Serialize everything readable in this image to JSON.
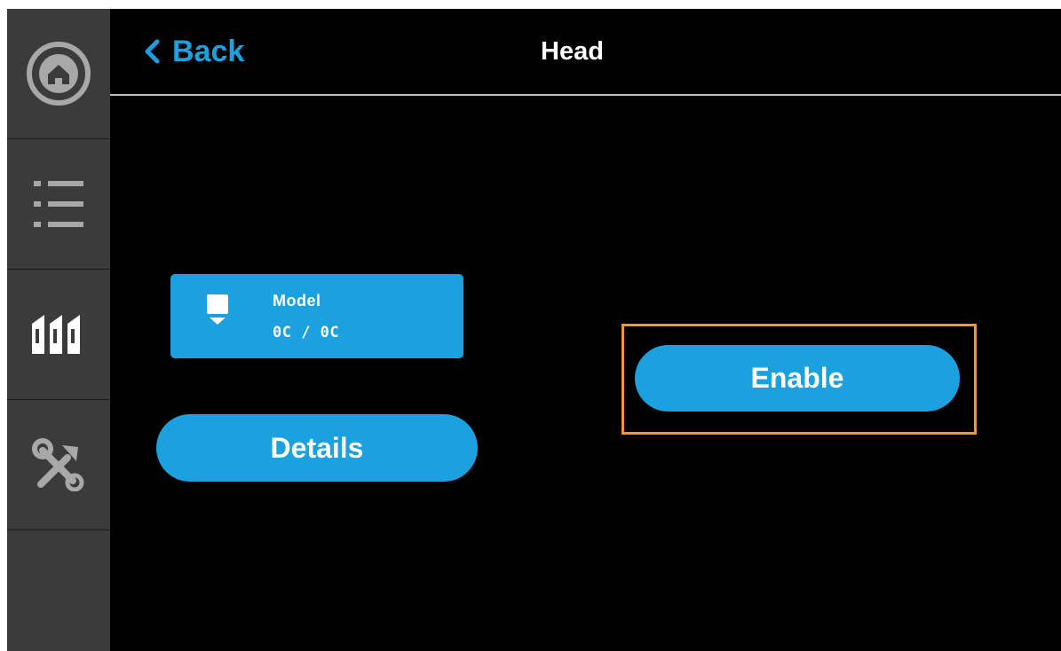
{
  "sidebar": {
    "items": [
      {
        "icon": "home-icon"
      },
      {
        "icon": "list-icon"
      },
      {
        "icon": "material-spools-icon"
      },
      {
        "icon": "tools-icon"
      }
    ]
  },
  "header": {
    "back_label": "Back",
    "back_icon": "chevron-left-icon",
    "title": "Head"
  },
  "head_card": {
    "icon": "print-head-icon",
    "model": "Model",
    "temperature": "0C / 0C"
  },
  "buttons": {
    "details": "Details",
    "enable": "Enable"
  },
  "colors": {
    "accent": "#1ba0e0",
    "sidebar": "#3b3b3b",
    "background": "#000000",
    "highlight": "#f7952e"
  }
}
